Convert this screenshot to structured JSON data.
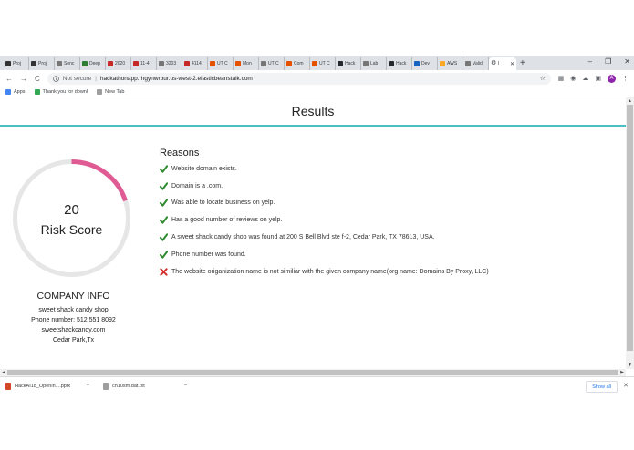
{
  "browser": {
    "tabs": [
      {
        "label": "Proj",
        "icon": "dark-app-icon",
        "color": "#333333"
      },
      {
        "label": "Proj",
        "icon": "dark-app-icon",
        "color": "#333333"
      },
      {
        "label": "Senc",
        "icon": "document-icon",
        "color": "#777777"
      },
      {
        "label": "Deep",
        "icon": "green-leaf-icon",
        "color": "#2e7d32"
      },
      {
        "label": "2020",
        "icon": "red-h-icon",
        "color": "#c62828"
      },
      {
        "label": "11-4",
        "icon": "red-h-icon",
        "color": "#c62828"
      },
      {
        "label": "3203",
        "icon": "document-icon",
        "color": "#777777"
      },
      {
        "label": "4114",
        "icon": "red-h-icon",
        "color": "#c62828"
      },
      {
        "label": "UT C",
        "icon": "orange-ut-icon",
        "color": "#e65100"
      },
      {
        "label": "Mon",
        "icon": "orange-ut-icon",
        "color": "#e65100"
      },
      {
        "label": "UT C",
        "icon": "document-icon",
        "color": "#777777"
      },
      {
        "label": "Com",
        "icon": "orange-ut-icon",
        "color": "#e65100"
      },
      {
        "label": "UT C",
        "icon": "orange-ut-icon",
        "color": "#e65100"
      },
      {
        "label": "Hack",
        "icon": "github-icon",
        "color": "#24292e"
      },
      {
        "label": "Lab",
        "icon": "document-icon",
        "color": "#777777"
      },
      {
        "label": "Hack",
        "icon": "github-icon",
        "color": "#24292e"
      },
      {
        "label": "Dev",
        "icon": "blue-dev-icon",
        "color": "#1565c0"
      },
      {
        "label": "AWS",
        "icon": "yellow-aws-icon",
        "color": "#f9a825"
      },
      {
        "label": "Valid",
        "icon": "document-icon",
        "color": "#777777"
      }
    ],
    "active_tab": {
      "label": "I",
      "icon": "gear-icon"
    },
    "new_tab_symbol": "+",
    "window_controls": {
      "minimize": "–",
      "restore": "❐",
      "close": "✕"
    },
    "nav": {
      "back": "←",
      "forward": "→",
      "reload": "C"
    },
    "address": {
      "security": "Not secure",
      "separator": "|",
      "url": "hackathonapp.rhgynwrbur.us-west-2.elasticbeanstalk.com"
    },
    "avatar_letter": "A",
    "bookmarks": [
      {
        "label": "Apps",
        "color": "#4285f4"
      },
      {
        "label": "Thank you for downl",
        "color": "#34a853"
      },
      {
        "label": "New Tab",
        "color": "#9e9e9e"
      }
    ]
  },
  "page": {
    "header_title": "Results",
    "accent_color": "#4bbfc4",
    "score": {
      "value": "20",
      "label": "Risk Score",
      "fraction": 0.2,
      "ring_color": "#e05a93",
      "track_color": "#e6e6e6"
    },
    "company": {
      "title": "COMPANY INFO",
      "name": "sweet shack candy shop",
      "phone": "Phone number: 512 551 8092",
      "website": "sweetshackcandy.com",
      "location": "Cedar Park,Tx"
    },
    "reasons": {
      "title": "Reasons",
      "items": [
        {
          "text": "Website domain exists.",
          "status": "pass"
        },
        {
          "text": "Domain is a .com.",
          "status": "pass"
        },
        {
          "text": "Was able to locate business on yelp.",
          "status": "pass"
        },
        {
          "text": "Has a good number of reviews on yelp.",
          "status": "pass"
        },
        {
          "text": "A sweet shack candy shop was found at 200 S Bell Blvd ste f-2, Cedar Park, TX 78613, USA.",
          "status": "pass"
        },
        {
          "text": "Phone number was found.",
          "status": "pass"
        },
        {
          "text": "The website origanization name is not similiar with the given company name(org name: Domains By Proxy, LLC)",
          "status": "fail"
        }
      ]
    }
  },
  "downloads": {
    "items": [
      {
        "label": "HackAI18_Openin....pptx",
        "color": "#d24726"
      },
      {
        "label": "ch10sm.dat.txt",
        "color": "#9e9e9e"
      }
    ],
    "show_all": "Show all",
    "close": "✕"
  }
}
